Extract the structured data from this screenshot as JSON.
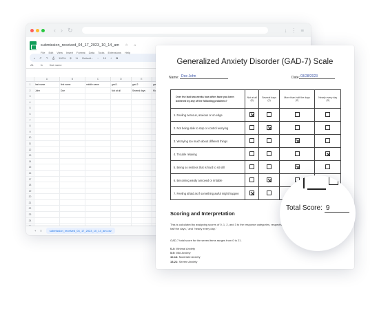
{
  "browser": {
    "doc_title": "submission_received_04_17_2023_10_14_am",
    "menu": [
      "File",
      "Edit",
      "View",
      "Insert",
      "Format",
      "Data",
      "Tools",
      "Extensions",
      "Help"
    ],
    "toolbar": {
      "zoom": "100%",
      "font": "Default...",
      "font_size": "10"
    },
    "cell_ref": "A1",
    "formula": "first name",
    "columns": [
      "A",
      "B",
      "C",
      "D",
      "E",
      "F",
      "G"
    ],
    "header_row": [
      "last name",
      "first name",
      "middle name",
      "gad-1",
      "gad-2",
      "gad-3",
      ""
    ],
    "data_row": [
      "John",
      "Doe",
      "",
      "Not at all",
      "Several days",
      "More than half",
      ""
    ],
    "row_count": 27,
    "sheet_tab": "submission_received_04_17_2023_10_14_am.csv"
  },
  "paper": {
    "title": "Generalized Anxiety Disorder (GAD-7) Scale",
    "name_label": "Name:",
    "name_value": "Doe John",
    "date_label": "Date:",
    "date_value": "03/28/2023",
    "question_header": "Over the last two weeks how often have you been bothered by any of the following problems?",
    "options": [
      {
        "label": "Not at all",
        "score": "(0)"
      },
      {
        "label": "Several days",
        "score": "(1)"
      },
      {
        "label": "More than half the days",
        "score": "(2)"
      },
      {
        "label": "Nearly every day",
        "score": "(3)"
      }
    ],
    "questions": [
      {
        "text": "1.  Feeling nervous, anxious or on edge",
        "checked": 0
      },
      {
        "text": "2.  Not being able to stop or control worrying",
        "checked": 1
      },
      {
        "text": "3.  Worrying too much about different things",
        "checked": 2
      },
      {
        "text": "4.  Trouble relaxing",
        "checked": 3
      },
      {
        "text": "5.  Being so restless that is hard to sit still",
        "checked": 2
      },
      {
        "text": "6.  Becoming easily annoyed or irritable",
        "checked": 1
      },
      {
        "text": "7.  Feeling afraid as if something awful might happen",
        "checked": 0
      }
    ],
    "scoring": {
      "heading": "Scoring and Interpretation",
      "paragraph": "This is calculated by assigning scores of 0, 1, 2, and 3 to the response categories, respectively, of \"not at all,\" \"several days,\" \"More than half the days,\" and \"nearly every day.\"",
      "total_note": "GAD-7 total score for the seven items ranges from 0 to 21.",
      "ranges": [
        {
          "range": "0-4:",
          "label": "Minimal Anxiety"
        },
        {
          "range": "5-9:",
          "label": "Mild Anxiety"
        },
        {
          "range": "10-14:",
          "label": "Moderate Anxiety"
        },
        {
          "range": "15-21:",
          "label": "Severe Anxiety"
        }
      ]
    }
  },
  "magnifier": {
    "total_label": "Total Score:",
    "total_value": "9"
  }
}
